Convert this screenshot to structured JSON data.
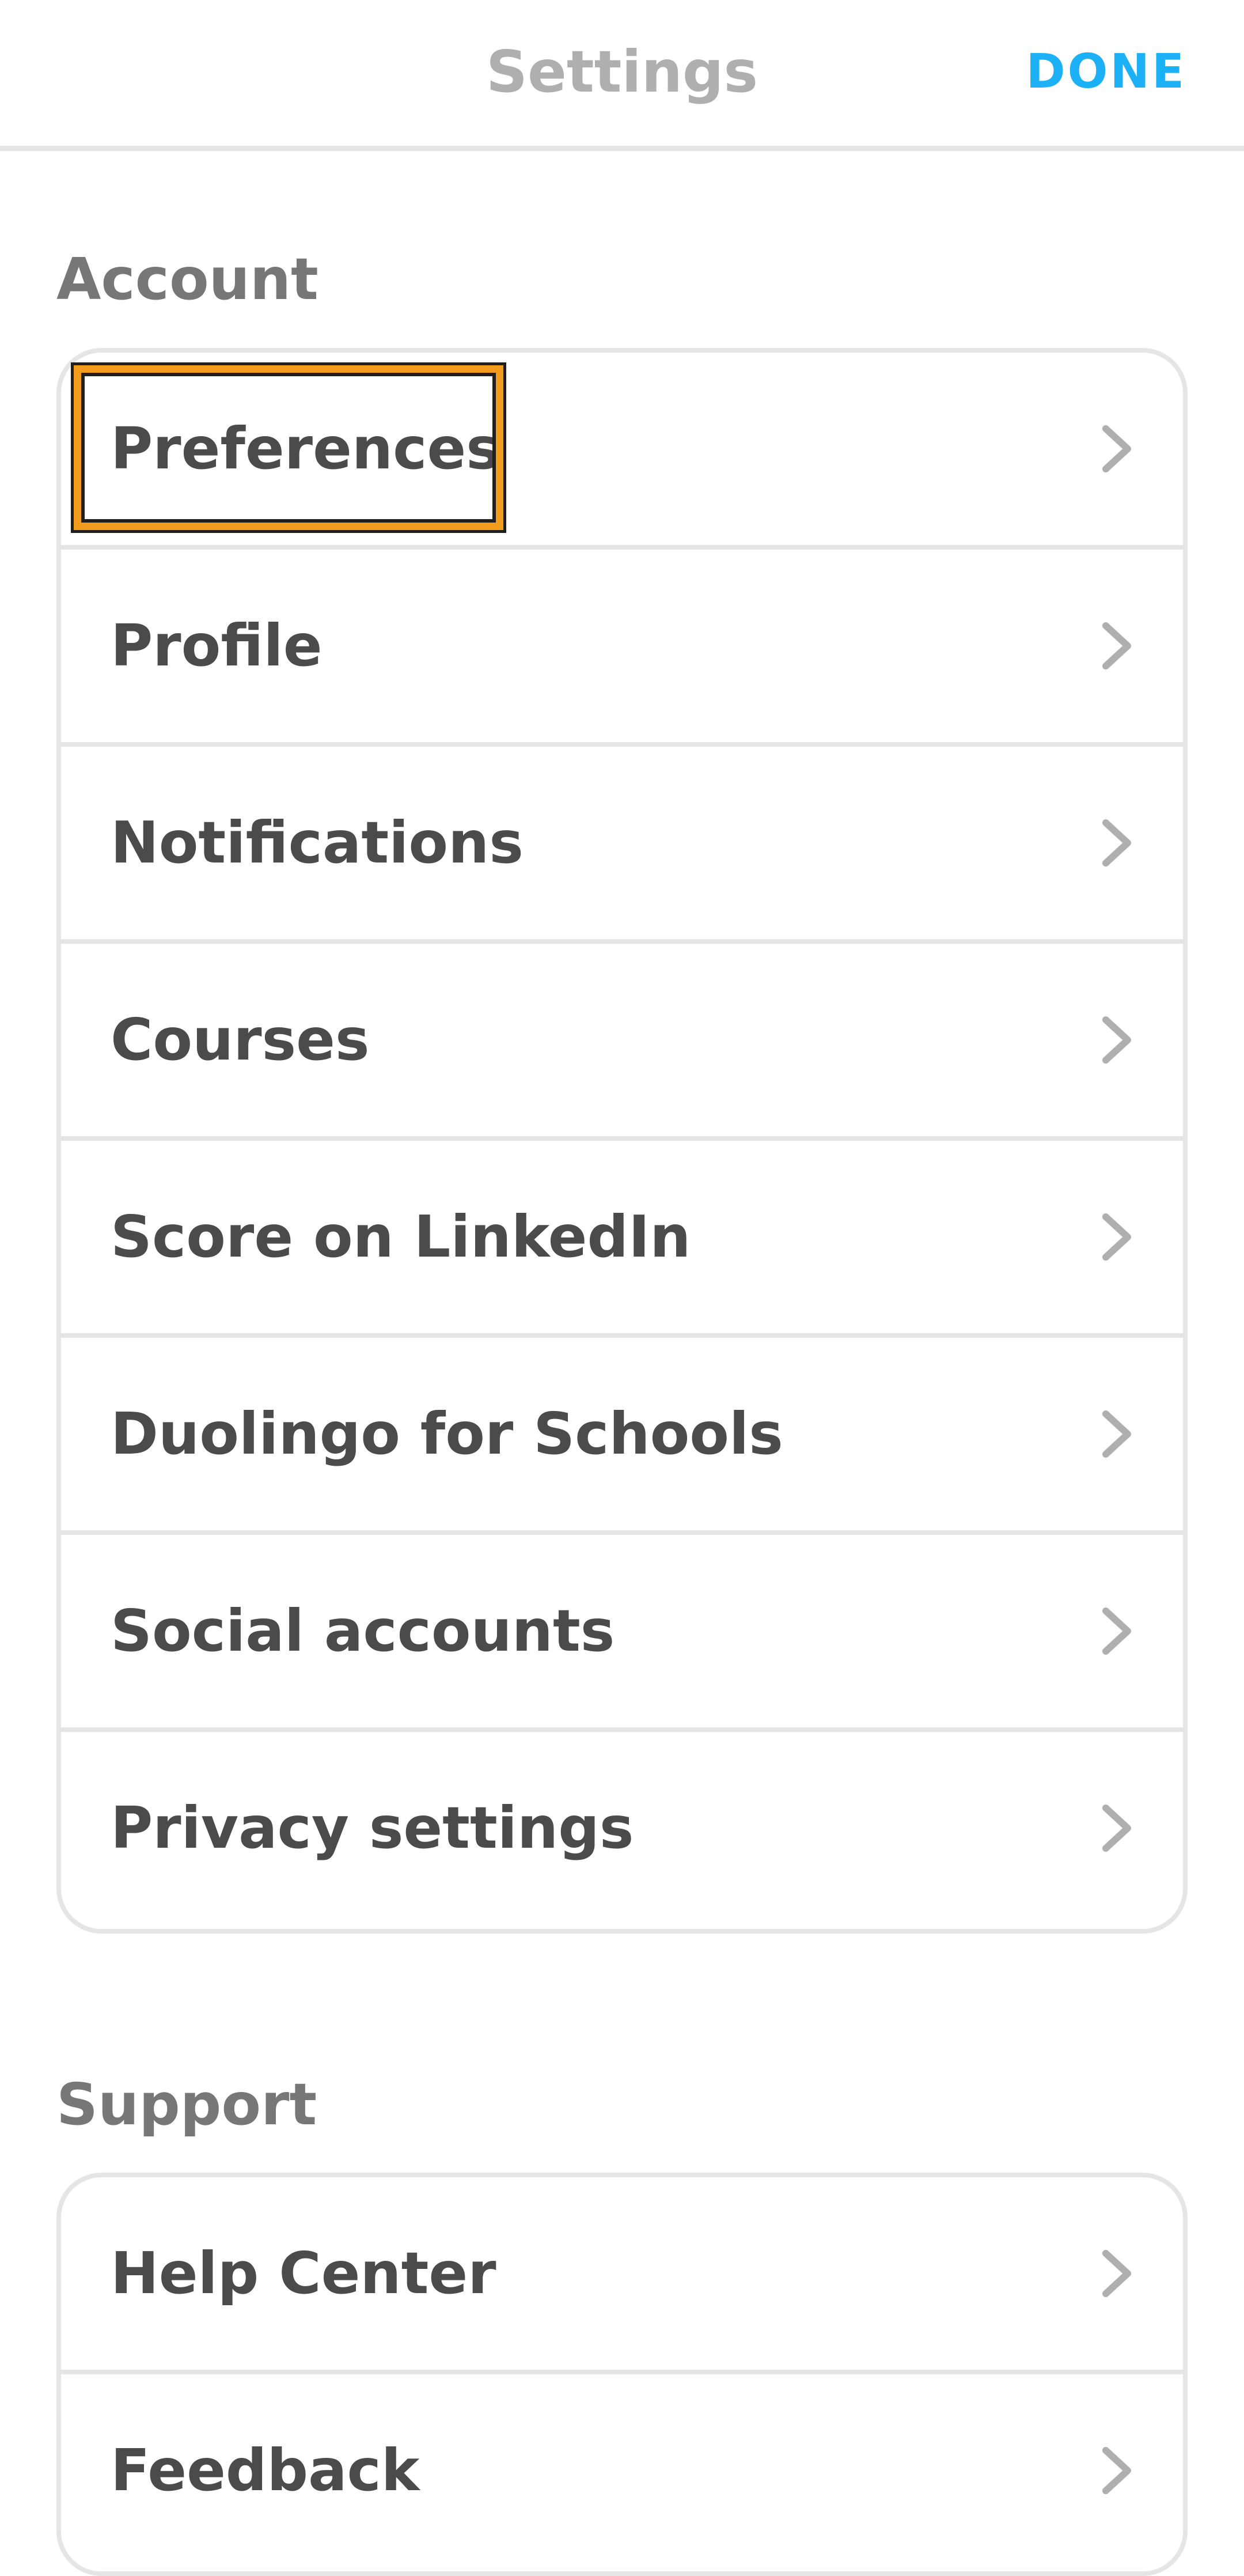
{
  "header": {
    "title": "Settings",
    "done_label": "DONE"
  },
  "sections": {
    "account": {
      "label": "Account",
      "items": [
        {
          "label": "Preferences",
          "icon": "chevron-right-icon"
        },
        {
          "label": "Profile",
          "icon": "chevron-right-icon"
        },
        {
          "label": "Notifications",
          "icon": "chevron-right-icon"
        },
        {
          "label": "Courses",
          "icon": "chevron-right-icon"
        },
        {
          "label": "Score on LinkedIn",
          "icon": "chevron-right-icon"
        },
        {
          "label": "Duolingo for Schools",
          "icon": "chevron-right-icon"
        },
        {
          "label": "Social accounts",
          "icon": "chevron-right-icon"
        },
        {
          "label": "Privacy settings",
          "icon": "chevron-right-icon"
        }
      ]
    },
    "support": {
      "label": "Support",
      "items": [
        {
          "label": "Help Center",
          "icon": "chevron-right-icon"
        },
        {
          "label": "Feedback",
          "icon": "chevron-right-icon"
        }
      ]
    }
  },
  "colors": {
    "accent": "#1cb0f6",
    "focus_highlight": "#f29b1d",
    "title_gray": "#afafaf",
    "section_gray": "#777777",
    "label_dark": "#4b4b4b",
    "divider": "#e5e5e5",
    "chevron": "#afafaf"
  }
}
